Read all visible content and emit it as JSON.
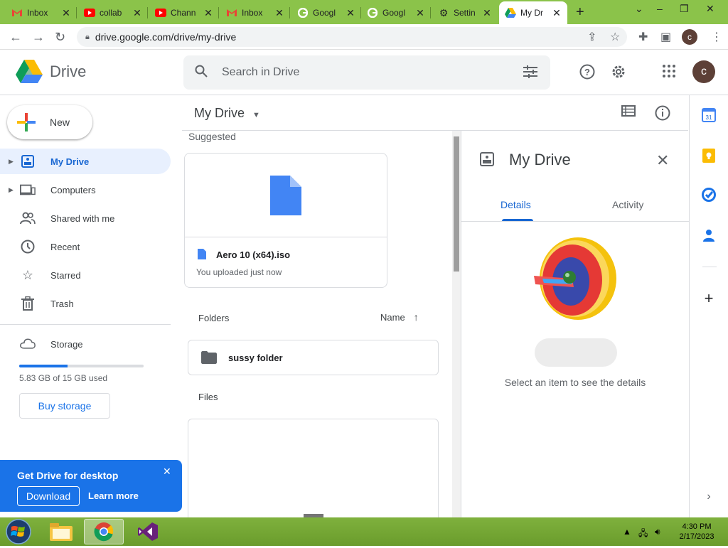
{
  "browser": {
    "tabs": [
      {
        "title": "Inbox",
        "icon": "gmail-icon"
      },
      {
        "title": "collab",
        "icon": "youtube-icon"
      },
      {
        "title": "Chann",
        "icon": "youtube-icon"
      },
      {
        "title": "Inbox",
        "icon": "gmail-icon"
      },
      {
        "title": "Googl",
        "icon": "google-icon"
      },
      {
        "title": "Googl",
        "icon": "google-icon"
      },
      {
        "title": "Settin",
        "icon": "settings-icon"
      },
      {
        "title": "My Dr",
        "icon": "drive-icon"
      }
    ],
    "url": "drive.google.com/drive/my-drive",
    "profile_initial": "c"
  },
  "header": {
    "app_name": "Drive",
    "search_placeholder": "Search in Drive",
    "avatar_initial": "c"
  },
  "sidebar": {
    "new_label": "New",
    "items": [
      {
        "label": "My Drive",
        "icon": "my-drive-icon",
        "active": true,
        "expandable": true
      },
      {
        "label": "Computers",
        "icon": "computers-icon",
        "active": false,
        "expandable": true
      },
      {
        "label": "Shared with me",
        "icon": "people-icon",
        "active": false,
        "expandable": false
      },
      {
        "label": "Recent",
        "icon": "clock-icon",
        "active": false,
        "expandable": false
      },
      {
        "label": "Starred",
        "icon": "star-icon",
        "active": false,
        "expandable": false
      },
      {
        "label": "Trash",
        "icon": "trash-icon",
        "active": false,
        "expandable": false
      }
    ],
    "storage_label": "Storage",
    "storage_used_text": "5.83 GB of 15 GB used",
    "storage_used_fraction": 0.389,
    "buy_label": "Buy storage",
    "promo": {
      "title": "Get Drive for desktop",
      "download_label": "Download",
      "learn_more_label": "Learn more"
    }
  },
  "main": {
    "title": "My Drive",
    "suggested_label": "Suggested",
    "suggested_file": {
      "name": "Aero 10 (x64).iso",
      "subtitle": "You uploaded just now"
    },
    "folders_label": "Folders",
    "sort_label": "Name",
    "folders": [
      {
        "name": "sussy folder"
      }
    ],
    "files_label": "Files"
  },
  "details": {
    "title": "My Drive",
    "tab_details": "Details",
    "tab_activity": "Activity",
    "empty_message": "Select an item to see the details"
  },
  "rail": {
    "calendar_day": "31"
  },
  "taskbar": {
    "time": "4:30 PM",
    "date": "2/17/2023"
  },
  "colors": {
    "accent": "#1a73e8",
    "active_nav_bg": "#e8f0fe",
    "taskbar": "#7fb13d",
    "tabstrip": "#8bc34a"
  }
}
